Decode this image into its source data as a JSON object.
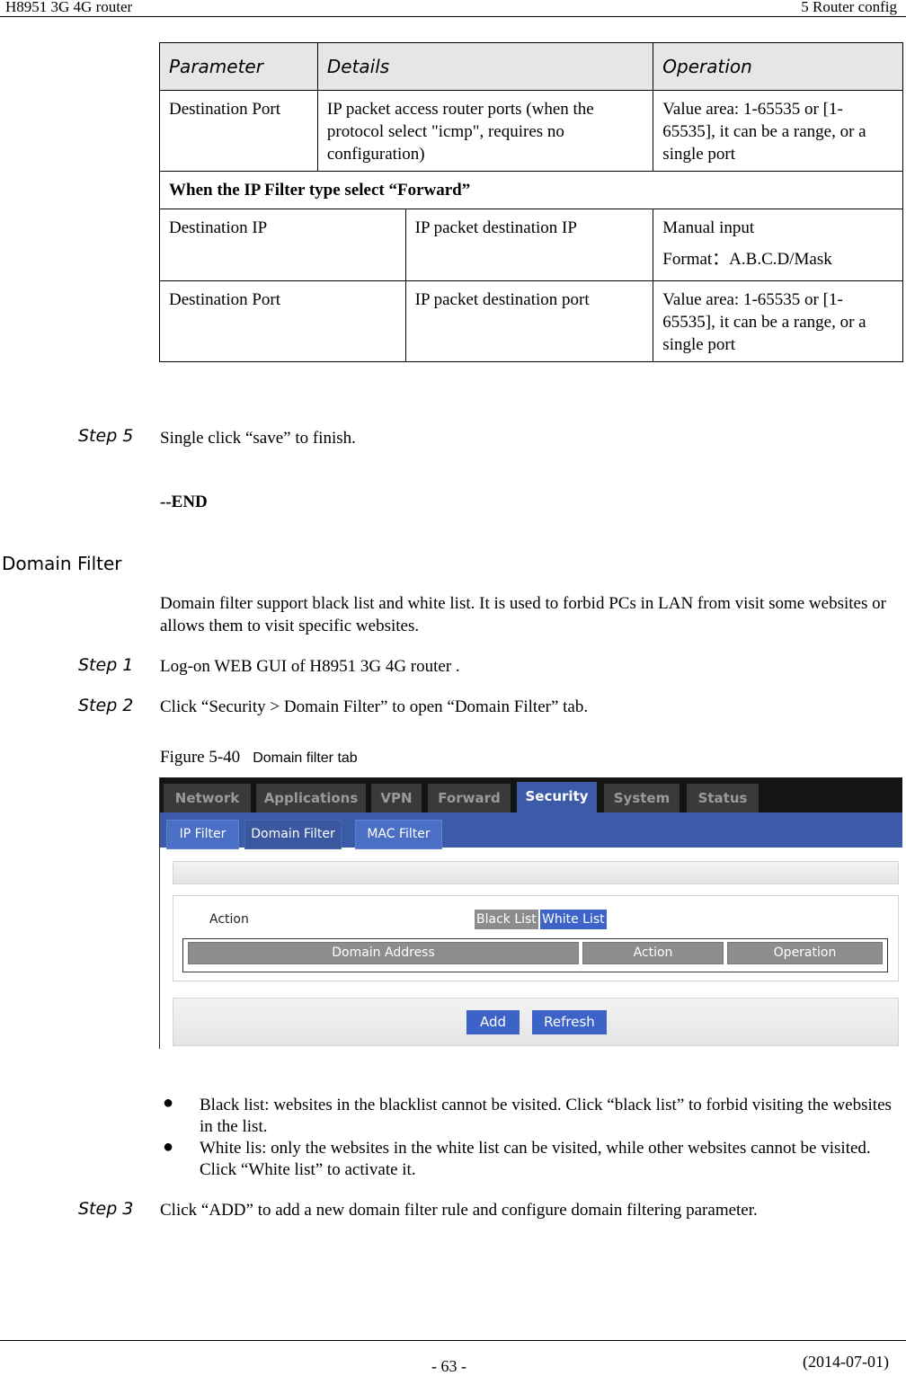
{
  "header": {
    "doc_title": "H8951 3G 4G router",
    "chapter": "5  Router config"
  },
  "param_table": {
    "headers": [
      "Parameter",
      "Details",
      "Operation"
    ],
    "row_dest_port": {
      "parameter": "Destination Port",
      "details": "IP packet access router ports (when the protocol select \"icmp\", requires no configuration)",
      "operation": "Value area: 1-65535 or [1-65535], it can be a range, or a single port"
    },
    "section_label": "When the IP Filter type select “Forward”",
    "forward_rows": [
      {
        "parameter": "Destination IP",
        "details": "IP packet destination IP",
        "operation": "Manual input",
        "operation_format": "Format：A.B.C.D/Mask"
      },
      {
        "parameter": "Destination Port",
        "details": "IP packet destination port",
        "operation": "Value area: 1-65535 or [1-65535], it can be a range, or a single port"
      }
    ]
  },
  "steps_before": {
    "step5": {
      "label": "Step 5",
      "text": "Single click “save” to finish."
    },
    "end": "--END"
  },
  "section": {
    "title": "Domain Filter",
    "intro": "Domain filter support black list and white list. It is used to forbid PCs in LAN from visit some websites or allows them to visit specific websites.",
    "step1": {
      "label": "Step 1",
      "text": "Log-on WEB GUI of H8951 3G 4G router ."
    },
    "step2": {
      "label": "Step 2",
      "text": "Click “Security > Domain Filter” to open “Domain Filter” tab."
    },
    "figure": {
      "number": "Figure 5-40",
      "title": "Domain filter tab"
    },
    "bullets": [
      "Black list: websites in the blacklist cannot be visited. Click “black list” to forbid visiting the websites in the list.",
      "White lis: only the websites in the white list can be visited, while other websites cannot be visited. Click “White list” to activate it."
    ],
    "bullet_glyph": "●",
    "step3": {
      "label": "Step 3",
      "text": "Click “ADD” to add a new domain filter rule and configure domain filtering parameter."
    }
  },
  "router_ui": {
    "main_tabs": [
      "Network",
      "Applications",
      "VPN",
      "Forward",
      "Security",
      "System",
      "Status"
    ],
    "active_main_tab": "Security",
    "sub_tabs": [
      "IP Filter",
      "Domain Filter",
      "MAC Filter"
    ],
    "active_sub_tab": "Domain Filter",
    "action_label": "Action",
    "list_buttons": {
      "black": "Black List",
      "white": "White List"
    },
    "selected_list": "White List",
    "grid_headers": [
      "Domain Address",
      "Action",
      "Operation"
    ],
    "buttons": {
      "add": "Add",
      "refresh": "Refresh"
    },
    "colors": {
      "accent_blue": "#3d63c9",
      "nav_bar": "#3b5ba8",
      "top_bar": "#141414",
      "header_gray": "#8d8d8d"
    }
  },
  "footer": {
    "page": "- 63 -",
    "date": "(2014-07-01)"
  }
}
